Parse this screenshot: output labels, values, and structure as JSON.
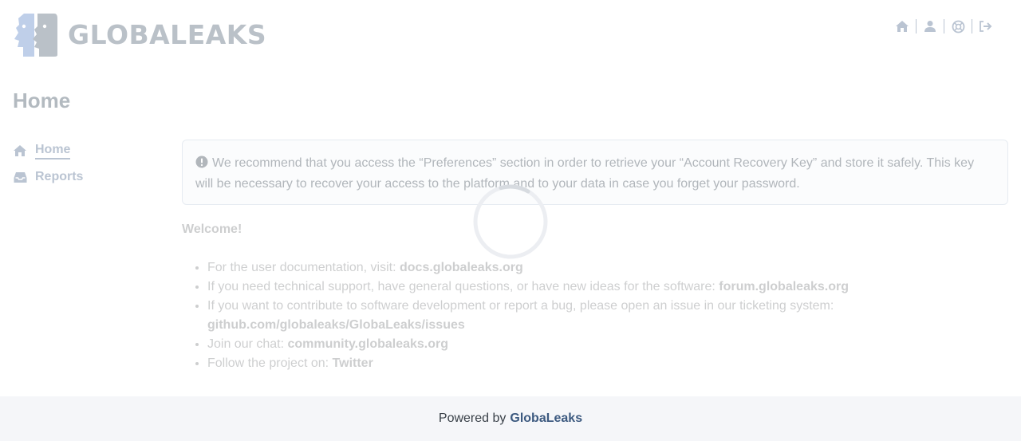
{
  "app": {
    "logo_text": "GLOBALEAKS"
  },
  "top_nav": {
    "items": [
      {
        "icon": "home-icon"
      },
      {
        "icon": "user-icon"
      },
      {
        "icon": "help-icon"
      },
      {
        "icon": "logout-icon"
      }
    ]
  },
  "page": {
    "title": "Home"
  },
  "sidebar": {
    "items": [
      {
        "label": "Home",
        "icon": "home-icon",
        "active": true
      },
      {
        "label": "Reports",
        "icon": "inbox-icon",
        "active": false
      }
    ]
  },
  "alert": {
    "icon": "exclamation-circle-icon",
    "text": "We recommend that you access the “Preferences” section in order to retrieve your “Account Recovery Key” and store it safely. This key will be necessary to recover your access to the platform and to your data in case you forget your password."
  },
  "welcome": {
    "title": "Welcome!",
    "items": [
      {
        "text": "For the user documentation, visit: ",
        "link": "docs.globaleaks.org"
      },
      {
        "text": "If you need technical support, have general questions, or have new ideas for the software: ",
        "link": "forum.globaleaks.org"
      },
      {
        "text": "If you want to contribute to software development or report a bug, please open an issue in our ticketing system: ",
        "link": "github.com/globaleaks/GlobaLeaks/issues"
      },
      {
        "text": "Join our chat: ",
        "link": "community.globaleaks.org"
      },
      {
        "text": "Follow the project on: ",
        "link": "Twitter"
      }
    ]
  },
  "footer": {
    "prefix": "Powered by",
    "link": "GlobaLeaks"
  },
  "colors": {
    "accent": "#3d5a80",
    "footer_bg": "#f5f6f9"
  }
}
